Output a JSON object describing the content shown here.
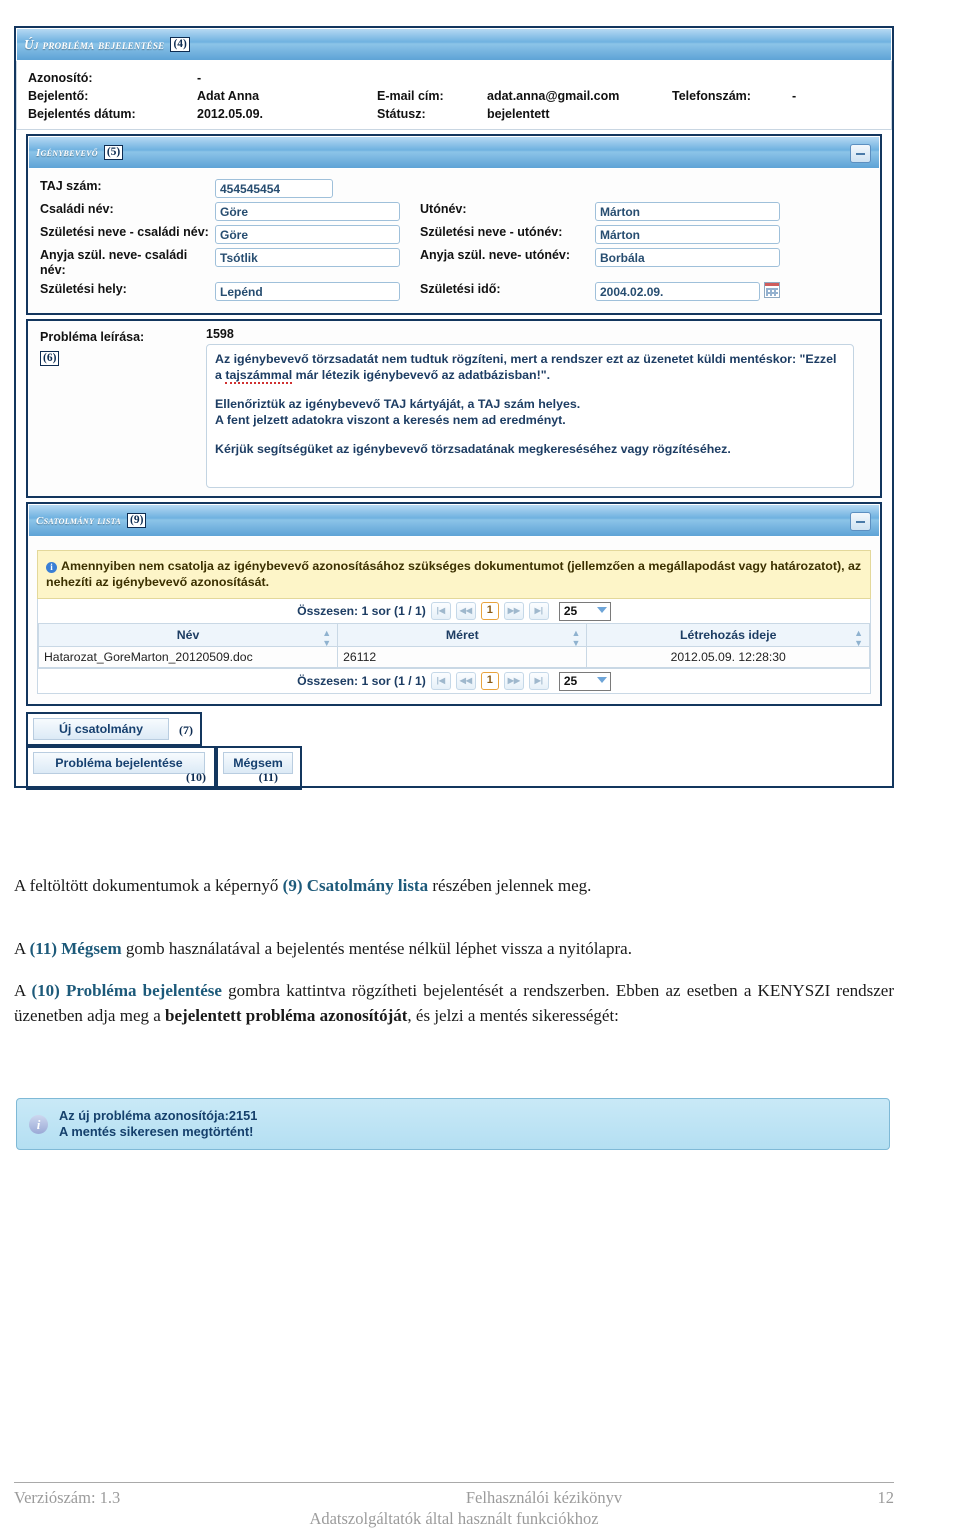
{
  "screenshot": {
    "titlebar": {
      "text": "Új probléma bejelentése",
      "annotation": "(4)"
    },
    "header_fields": {
      "row1": {
        "label": "Azonosító:",
        "value": "-"
      },
      "row2": {
        "label": "Bejelentő:",
        "value": "Adat Anna",
        "label2": "E-mail cím:",
        "value2": "adat.anna@gmail.com",
        "label3": "Telefonszám:",
        "value3": "-"
      },
      "row3": {
        "label": "Bejelentés dátum:",
        "value": "2012.05.09.",
        "label2": "Státusz:",
        "value2": "bejelentett"
      }
    },
    "beneficiary": {
      "title": "Igénybevevő",
      "annotation": "(5)",
      "collapse_icon": "minus-icon",
      "taj_label": "TAJ szám:",
      "taj_value": "454545454",
      "rows": [
        {
          "label": "Családi név:",
          "value": "Göre",
          "label2": "Utónév:",
          "value2": "Márton"
        },
        {
          "label": "Születési neve - családi név:",
          "value": "Göre",
          "label2": "Születési neve - utónév:",
          "value2": "Márton"
        },
        {
          "label": "Anyja szül. neve- családi név:",
          "value": "Tsótlik",
          "label2": "Anyja szül. neve- utónév:",
          "value2": "Borbála"
        },
        {
          "label": "Születési hely:",
          "value": "Lepénd",
          "label2": "Születési idő:",
          "value2": "2004.02.09."
        }
      ]
    },
    "problem": {
      "label": "Probléma leírása:",
      "annotation": "(6)",
      "char_count": "1598",
      "paragraphs": [
        "Az igénybevevő törzsadatát nem tudtuk rögzíteni, mert a rendszer ezt az üzenetet küldi mentéskor: \"Ezzel a tajszámmal már létezik igénybevevő az adatbázisban!\".",
        "Ellenőriztük az igénybevevő TAJ kártyáját, a TAJ szám helyes.\nA fent jelzett adatokra viszont a keresés nem ad eredményt.",
        "Kérjük segítségüket az igénybevevő törzsadatának megkereséséhez vagy rögzítéséhez."
      ],
      "p2_line1": "Ellenőriztük az igénybevevő TAJ kártyáját, a TAJ szám helyes.",
      "p2_line2": "A fent jelzett adatokra viszont a keresés nem ad eredményt."
    },
    "attachments": {
      "title": "Csatolmány lista",
      "annotation": "(9)",
      "collapse_icon": "minus-icon",
      "warning_icon": "info-icon",
      "warning_text": "Amennyiben nem csatolja az igénybevevő azonosításához szükséges dokumentumot (jellemzően a megállapodást vagy határozatot), az nehezíti az igénybevevő azonosítását.",
      "pager": {
        "summary": "Összesen: 1 sor (1 / 1)",
        "first_icon": "first-page-icon",
        "prev_icon": "prev-page-icon",
        "current_page": "1",
        "next_icon": "next-page-icon",
        "last_icon": "last-page-icon",
        "page_size": "25",
        "page_size_arrow": "chevron-down-icon"
      },
      "columns": [
        "Név",
        "Méret",
        "Létrehozás ideje"
      ],
      "sort_icon": "sort-icon",
      "rows": [
        {
          "name": "Hatarozat_GoreMarton_20120509.doc",
          "size": "26112",
          "created": "2012.05.09. 12:28:30"
        }
      ]
    },
    "buttons": {
      "new_attachment": {
        "label": "Új csatolmány",
        "annotation": "(7)"
      },
      "report_problem": {
        "label": "Probléma bejelentése",
        "annotation": "(10)"
      },
      "cancel": {
        "label": "Mégsem",
        "annotation": "(11)"
      }
    }
  },
  "body_text": {
    "para1_a": "A feltöltött dokumentumok a képernyő ",
    "para1_hl": "(9) Csatolmány lista",
    "para1_b": " részében jelennek meg.",
    "para2_a": "A ",
    "para2_hl": "(11) Mégsem",
    "para2_b": " gomb használatával a bejelentés mentése nélkül léphet vissza a nyitólapra.",
    "para3_a": "A ",
    "para3_hl": "(10) Probléma bejelentése",
    "para3_b": " gombra kattintva rögzítheti bejelentését a rendszerben. Ebben az esetben a KENYSZI rendszer üzenetben adja meg a ",
    "para3_bold": "bejelentett probléma azonosítóját",
    "para3_c": ", és jelzi a mentés sikerességét:"
  },
  "success_message": {
    "icon": "info-icon",
    "line1": "Az új probléma azonosítója:2151",
    "line2": "A mentés sikeresen megtörtént!"
  },
  "footer": {
    "version": "Verziószám: 1.3",
    "title": "Felhasználói kézikönyv",
    "page": "12",
    "subtitle": "Adatszolgáltatók által használt funkciókhoz"
  },
  "colors": {
    "navy_border": "#13365e",
    "title_blue": "#6fb1e0",
    "warn_yellow": "#fdf5c8",
    "msg_blue": "#c9e9f7",
    "highlight": "#1d5a7a"
  }
}
